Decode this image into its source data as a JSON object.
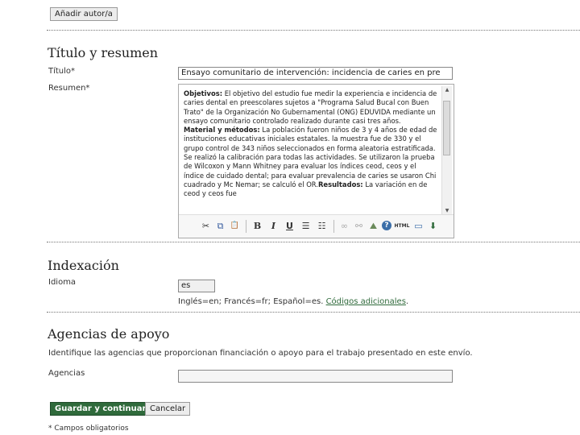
{
  "top_button": "Añadir autor/a",
  "titulo_section": {
    "heading": "Título y resumen",
    "title_label": "Título*",
    "title_value": "Ensayo  comunitario de  intervención:  incidencia de caries en pre",
    "abstract_label": "Resumen*",
    "abstract": {
      "obj_label": "Objetivos:",
      "obj_text": " El objetivo del estudio fue medir la experiencia e incidencia de caries dental en preescolares sujetos a \"Programa Salud Bucal con Buen Trato\" de la Organización No Gubernamental (ONG) EDUVIDA mediante un ensayo comunitario controlado realizado durante casi tres años.",
      "mat_label": "Material y métodos:",
      "mat_text": " La población fueron niños de 3 y 4 años de edad de instituciones educativas iniciales estatales. la muestra fue de 330 y el grupo control de 343 niños seleccionados en forma aleatoria estratificada. Se realizó la calibración para todas las actividades. Se utilizaron la prueba de Wilcoxon y Mann Whitney para evaluar los índices ceod, ceos y el índice de cuidado dental; para evaluar prevalencia de caries se usaron Chi cuadrado y Mc Nemar; se calculó el OR.",
      "res_label": "Resultados:",
      "res_text": "  La variación en de ceod y ceos fue"
    }
  },
  "indexacion": {
    "heading": "Indexación",
    "language_label": "Idioma",
    "language_value": "es",
    "hint_text": "Inglés=en; Francés=fr; Español=es. ",
    "hint_link": "Códigos adicionales",
    "hint_end": "."
  },
  "agencias": {
    "heading": "Agencias de apoyo",
    "description": "Identifique las agencias que proporcionan financiación o apoyo para el trabajo presentado en este envío.",
    "label": "Agencias",
    "value": ""
  },
  "actions": {
    "save": "Guardar y continuar",
    "cancel": "Cancelar"
  },
  "footnote": "* Campos obligatorios",
  "toolbar": {
    "cut": "✂",
    "copy": "⧉",
    "paste": "📋",
    "bold": "B",
    "italic": "I",
    "underline": "U",
    "bullets": "☰",
    "numbers": "☷",
    "link": "∞",
    "unlink": "⚯",
    "image": "⛰",
    "help": "?",
    "html": "HTML",
    "fullscreen": "▭",
    "upload": "⬇"
  },
  "colors": {
    "accent": "#2f6a3b",
    "link": "#2f6a3b"
  }
}
